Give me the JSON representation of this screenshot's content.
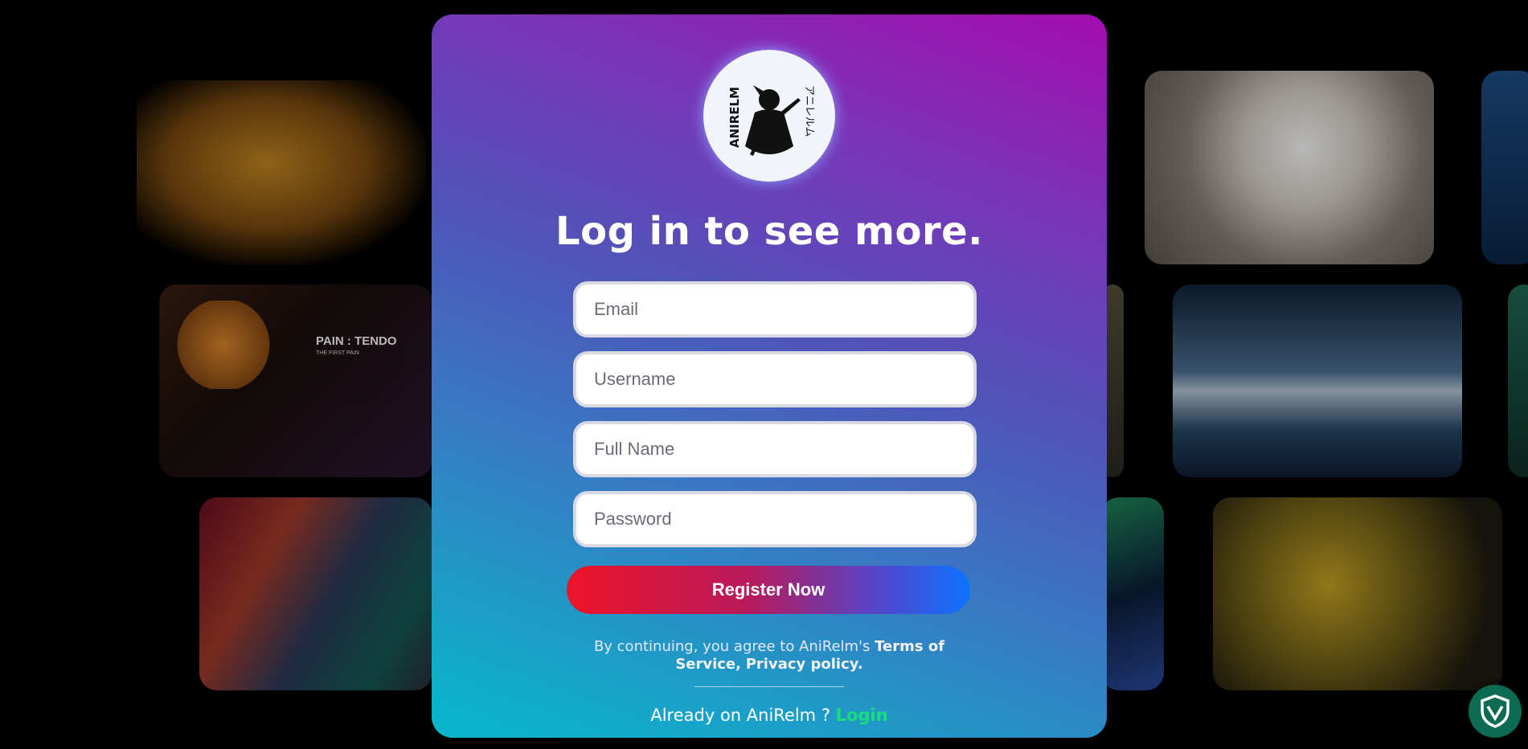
{
  "logo": {
    "icon": "samurai-logo-icon",
    "brand_text": "ANIRELM",
    "jp_text": "アニレルム"
  },
  "heading": "Log in to see more.",
  "form": {
    "email_placeholder": "Email",
    "username_placeholder": "Username",
    "fullname_placeholder": "Full Name",
    "password_placeholder": "Password",
    "register_label": "Register Now"
  },
  "terms": {
    "prefix": "By continuing, you agree to AniRelm's",
    "terms_link": "Terms of Service,",
    "privacy_link": "Privacy policy."
  },
  "footer": {
    "already_text": "Already on AniRelm ?",
    "login_label": "Login"
  },
  "background_tiles": {
    "pain_caption": "PAIN : TENDO",
    "pain_subcaption": "THE FIRST PAIN"
  },
  "widget": {
    "icon": "shield-icon",
    "color": "#0d6b52"
  },
  "colors": {
    "card_top": "#a40cb0",
    "card_bottom": "#06b8cc",
    "register_start": "#ee1429",
    "register_end": "#0d73ff",
    "login_link": "#17e07a"
  }
}
